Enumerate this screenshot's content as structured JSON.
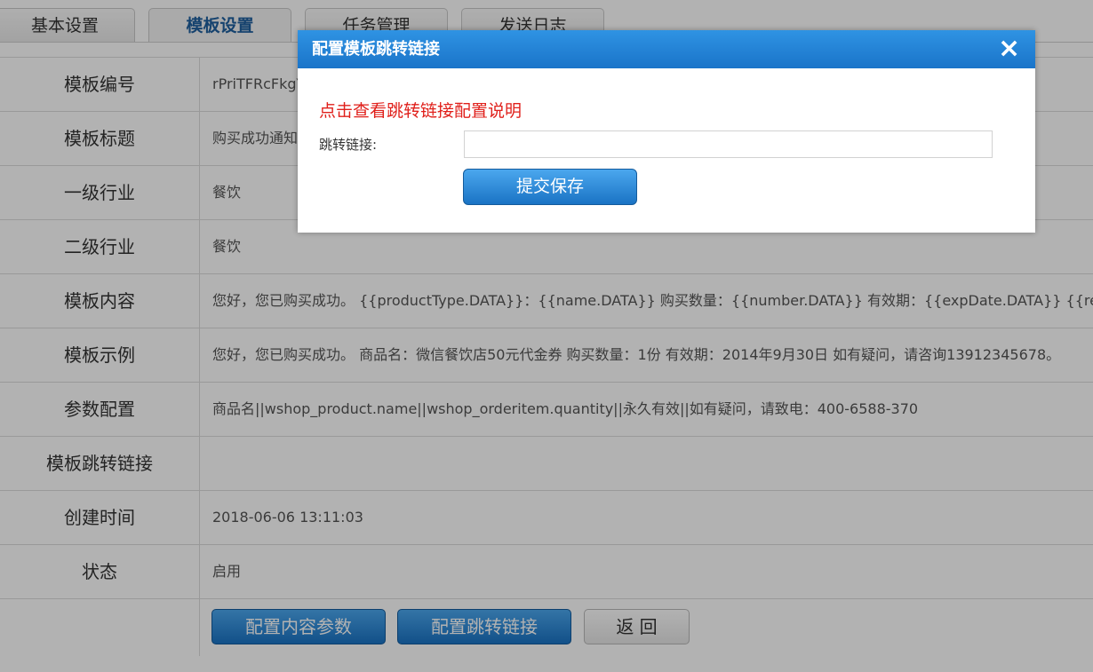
{
  "tabs": [
    "基本设置",
    "模板设置",
    "任务管理",
    "发送日志"
  ],
  "rows": [
    {
      "label": "模板编号",
      "value": "rPriTFRcFkgYU"
    },
    {
      "label": "模板标题",
      "value": "购买成功通知"
    },
    {
      "label": "一级行业",
      "value": "餐饮"
    },
    {
      "label": "二级行业",
      "value": "餐饮"
    },
    {
      "label": "模板内容",
      "value": "您好，您已购买成功。 {{productType.DATA}}：{{name.DATA}} 购买数量：{{number.DATA}} 有效期：{{expDate.DATA}} {{remark.DATA}}"
    },
    {
      "label": "模板示例",
      "value": "您好，您已购买成功。 商品名：微信餐饮店50元代金券 购买数量：1份 有效期：2014年9月30日 如有疑问，请咨询13912345678。"
    },
    {
      "label": "参数配置",
      "value": "商品名||wshop_product.name||wshop_orderitem.quantity||永久有效||如有疑问，请致电：400-6588-370"
    },
    {
      "label": "模板跳转链接",
      "value": ""
    },
    {
      "label": "创建时间",
      "value": "2018-06-06 13:11:03"
    },
    {
      "label": "状态",
      "value": "启用"
    }
  ],
  "actions": {
    "config_params": "配置内容参数",
    "config_link": "配置跳转链接",
    "back": "返 回"
  },
  "modal": {
    "title": "配置模板跳转链接",
    "close_icon": "×",
    "help_link": "点击查看跳转链接配置说明",
    "link_label": "跳转链接:",
    "link_value": "",
    "submit": "提交保存"
  },
  "colors": {
    "modal_header": "#1a74c9",
    "help_link": "#e0201b",
    "button_blue": "#1a73c4",
    "active_tab_text": "#1f5f9e"
  }
}
